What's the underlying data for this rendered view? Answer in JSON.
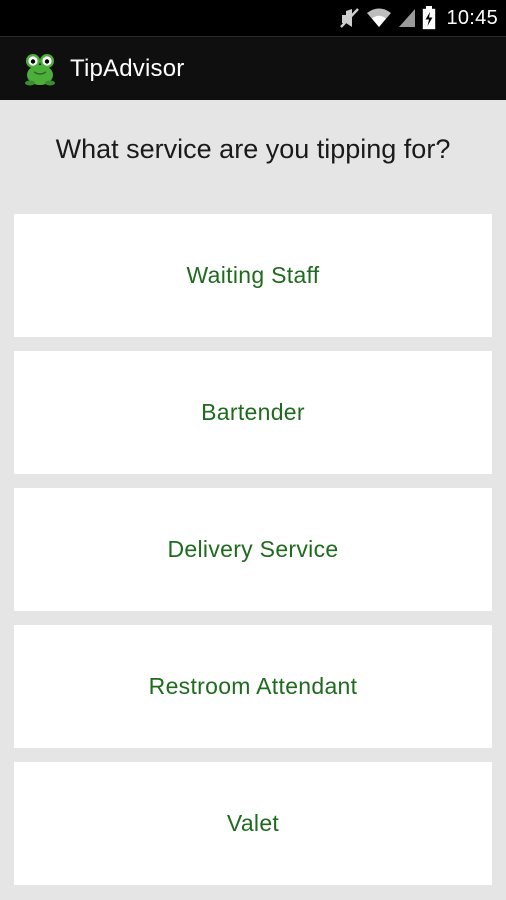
{
  "status_bar": {
    "time": "10:45",
    "icons": [
      "mute-icon",
      "wifi-icon",
      "signal-icon",
      "battery-charging-icon"
    ]
  },
  "app": {
    "title": "TipAdvisor",
    "icon": "frog-icon",
    "accent_color": "#1e6b1e"
  },
  "main": {
    "question": "What service are you tipping for?",
    "options": [
      {
        "label": "Waiting Staff"
      },
      {
        "label": "Bartender"
      },
      {
        "label": "Delivery Service"
      },
      {
        "label": "Restroom Attendant"
      },
      {
        "label": "Valet"
      }
    ]
  }
}
